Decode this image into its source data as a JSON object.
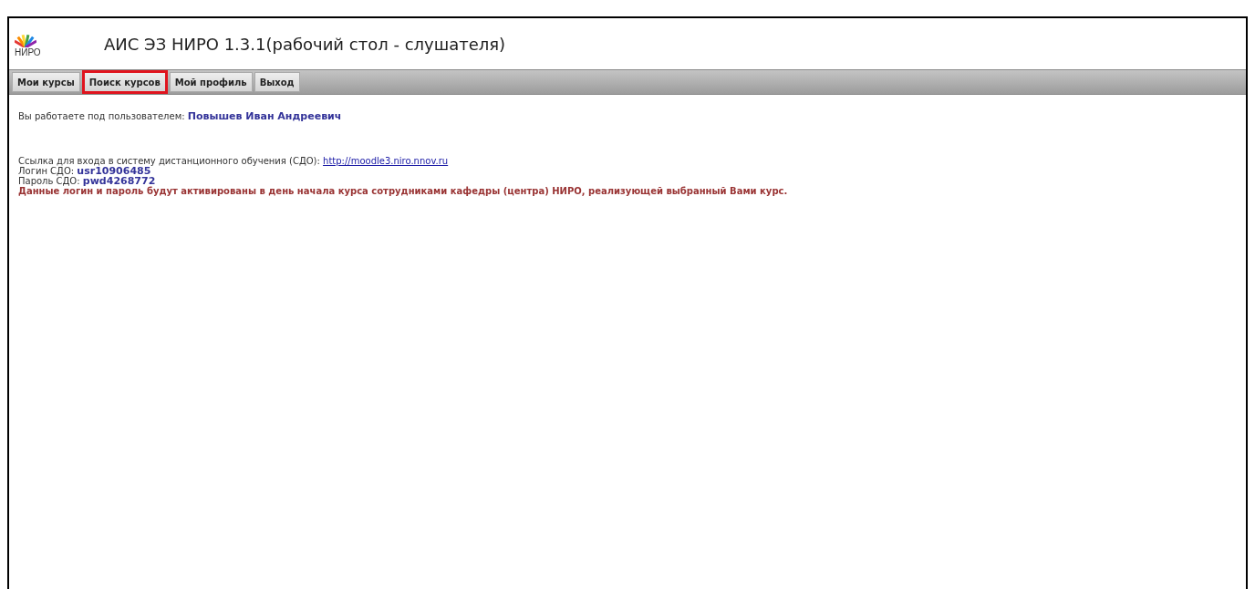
{
  "header": {
    "logo_text": "НИРО",
    "title": "АИС ЭЗ НИРО 1.3.1(рабочий стол - слушателя)"
  },
  "tabs": [
    {
      "label": "Мои курсы",
      "selected": false
    },
    {
      "label": "Поиск курсов",
      "selected": true
    },
    {
      "label": "Мой профиль",
      "selected": false
    },
    {
      "label": "Выход",
      "selected": false
    }
  ],
  "user": {
    "label": "Вы работаете под пользователем:",
    "name": "Повышев Иван Андреевич"
  },
  "credentials": {
    "link_label": "Ссылка для входа в систему дистанционного обучения (СДО):",
    "link": "http://moodle3.niro.nnov.ru",
    "login_label": "Логин СДО:",
    "login": "usr10906485",
    "password_label": "Пароль СДО:",
    "password": "pwd4268772",
    "notice": "Данные логин и пароль будут активированы в день начала курса сотрудниками кафедры (центра) НИРО, реализующей выбранный Вами курс."
  }
}
